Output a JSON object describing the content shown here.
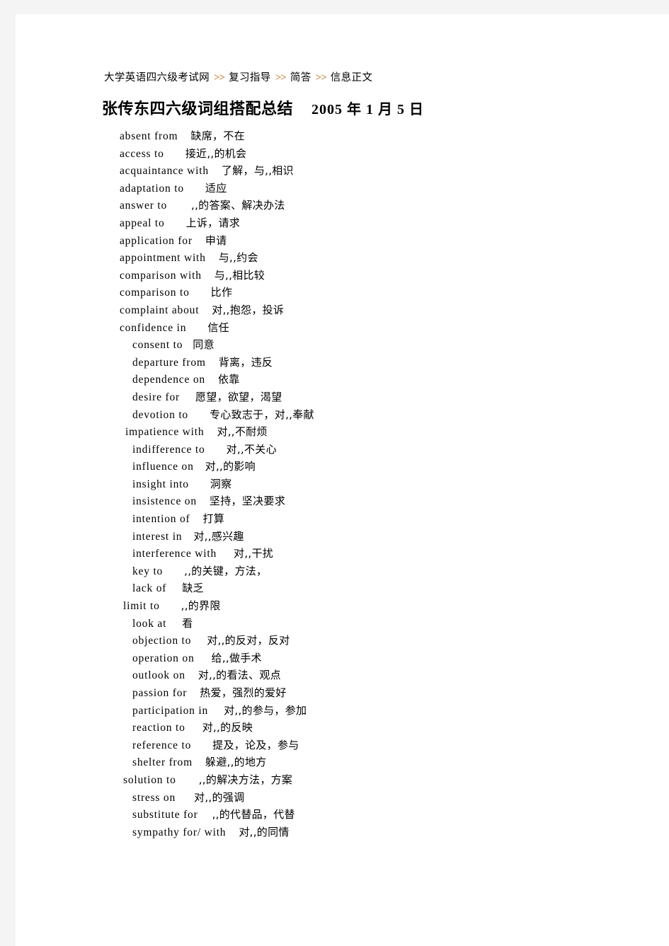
{
  "page": {
    "background_color": "#f4f4f4",
    "sheet_color": "#ffffff"
  },
  "breadcrumb": {
    "separator": ">>",
    "separator_color": "#c8813c",
    "items": [
      "大学英语四六级考试网",
      "复习指导",
      "简答",
      "信息正文"
    ]
  },
  "header": {
    "title": "张传东四六级词组搭配总结",
    "date": "2005 年 1 月 5 日"
  },
  "phrases": [
    {
      "en": "absent from",
      "cn": "缺席，不在",
      "indent": 147,
      "gap": 18
    },
    {
      "en": "access to",
      "cn": "接近,,的机会",
      "indent": 147,
      "gap": 30
    },
    {
      "en": "acquaintance with",
      "cn": "了解，与,,相识",
      "indent": 147,
      "gap": 18
    },
    {
      "en": "adaptation to",
      "cn": "适应",
      "indent": 147,
      "gap": 30
    },
    {
      "en": "answer to",
      "cn": ",,的答案、解决办法",
      "indent": 147,
      "gap": 34
    },
    {
      "en": "appeal to",
      "cn": "上诉，请求",
      "indent": 147,
      "gap": 30
    },
    {
      "en": "application for",
      "cn": "申请",
      "indent": 147,
      "gap": 18
    },
    {
      "en": "appointment with",
      "cn": "与,,约会",
      "indent": 147,
      "gap": 18
    },
    {
      "en": "comparison with",
      "cn": "与,,相比较",
      "indent": 147,
      "gap": 18
    },
    {
      "en": "comparison to",
      "cn": "比作",
      "indent": 147,
      "gap": 30
    },
    {
      "en": "complaint about",
      "cn": "对,,抱怨，投诉",
      "indent": 147,
      "gap": 18
    },
    {
      "en": "confidence in",
      "cn": "信任",
      "indent": 147,
      "gap": 30
    },
    {
      "en": "consent to",
      "cn": "同意",
      "indent": 165,
      "gap": 14
    },
    {
      "en": "departure from",
      "cn": "背离，违反",
      "indent": 165,
      "gap": 18
    },
    {
      "en": "dependence on",
      "cn": "依靠",
      "indent": 165,
      "gap": 18
    },
    {
      "en": "desire for",
      "cn": "愿望，欲望，渴望",
      "indent": 165,
      "gap": 22
    },
    {
      "en": "devotion to",
      "cn": "专心致志于，对,,奉献",
      "indent": 165,
      "gap": 30
    },
    {
      "en": "impatience with",
      "cn": "对,,不耐烦",
      "indent": 155,
      "gap": 18
    },
    {
      "en": "indifference to",
      "cn": "对,,不关心",
      "indent": 165,
      "gap": 30
    },
    {
      "en": "influence on",
      "cn": "对,,的影响",
      "indent": 165,
      "gap": 16
    },
    {
      "en": "insight into",
      "cn": "洞察",
      "indent": 165,
      "gap": 30
    },
    {
      "en": "insistence on",
      "cn": "坚持，坚决要求",
      "indent": 165,
      "gap": 18
    },
    {
      "en": "intention of",
      "cn": "打算",
      "indent": 165,
      "gap": 18
    },
    {
      "en": "interest in",
      "cn": "对,,感兴趣",
      "indent": 165,
      "gap": 16
    },
    {
      "en": "interference with",
      "cn": "对,,干扰",
      "indent": 165,
      "gap": 24
    },
    {
      "en": "key to",
      "cn": ",,的关键，方法，",
      "indent": 165,
      "gap": 30
    },
    {
      "en": "lack of",
      "cn": "缺乏",
      "indent": 165,
      "gap": 22
    },
    {
      "en": "limit to",
      "cn": ",,的界限",
      "indent": 152,
      "gap": 30
    },
    {
      "en": "look at",
      "cn": "看",
      "indent": 165,
      "gap": 22
    },
    {
      "en": "objection to",
      "cn": "对,,的反对，反对",
      "indent": 165,
      "gap": 22
    },
    {
      "en": "operation on",
      "cn": "给,,做手术",
      "indent": 165,
      "gap": 24
    },
    {
      "en": "outlook on",
      "cn": "对,,的看法、观点",
      "indent": 165,
      "gap": 18
    },
    {
      "en": "passion for",
      "cn": "热爱，强烈的爱好",
      "indent": 165,
      "gap": 18
    },
    {
      "en": "participation in",
      "cn": "对,,的参与，参加",
      "indent": 165,
      "gap": 22
    },
    {
      "en": "reaction to",
      "cn": "对,,的反映",
      "indent": 165,
      "gap": 24
    },
    {
      "en": "reference to",
      "cn": "提及，论及，参与",
      "indent": 165,
      "gap": 30
    },
    {
      "en": "shelter from",
      "cn": "躲避,,的地方",
      "indent": 165,
      "gap": 18
    },
    {
      "en": "solution to",
      "cn": ",,的解决方法，方案",
      "indent": 152,
      "gap": 32
    },
    {
      "en": "stress on",
      "cn": "对,,的强调",
      "indent": 165,
      "gap": 26
    },
    {
      "en": "substitute for",
      "cn": ",,的代替品，代替",
      "indent": 165,
      "gap": 20
    },
    {
      "en": "sympathy for/ with",
      "cn": "对,,的同情",
      "indent": 165,
      "gap": 18
    }
  ]
}
